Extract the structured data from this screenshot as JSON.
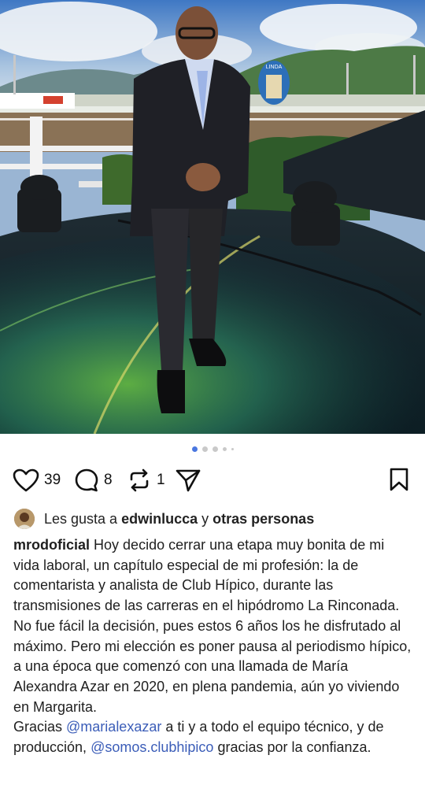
{
  "post": {
    "carousel": {
      "total": 5,
      "active_index": 0
    },
    "photo_signage": {
      "track_sign": "LINDA"
    }
  },
  "actions": {
    "like_count": "39",
    "comment_count": "8",
    "repost_count": "1"
  },
  "likes": {
    "prefix": "Les gusta a",
    "user": "edwinlucca",
    "connector": "y",
    "others": "otras personas"
  },
  "caption": {
    "username": "mrodoficial",
    "paragraph1": "Hoy decido cerrar una etapa muy bonita de mi vida laboral, un capítulo especial de mi profesión: la de comentarista y analista de Club Hípico, durante las transmisiones de las carreras en el hipódromo La Rinconada.",
    "paragraph2": "No fue fácil la decisión, pues estos 6 años los he disfrutado al máximo. Pero mi elección es poner pausa al periodismo hípico, a una época que comenzó con una llamada de María Alexandra Azar en 2020, en plena pandemia, aún yo viviendo en Margarita.",
    "thanks_prefix": "Gracias",
    "mention1": "@marialexazar",
    "thanks_middle": "a ti y a todo el equipo técnico, y de producción,",
    "mention2": "@somos.clubhipico",
    "thanks_suffix": "gracias por la confianza."
  },
  "colors": {
    "mention": "#3b5db8",
    "active_dot": "#4a77e0"
  },
  "icons": [
    "heart-icon",
    "comment-icon",
    "repost-icon",
    "share-icon",
    "bookmark-icon"
  ]
}
